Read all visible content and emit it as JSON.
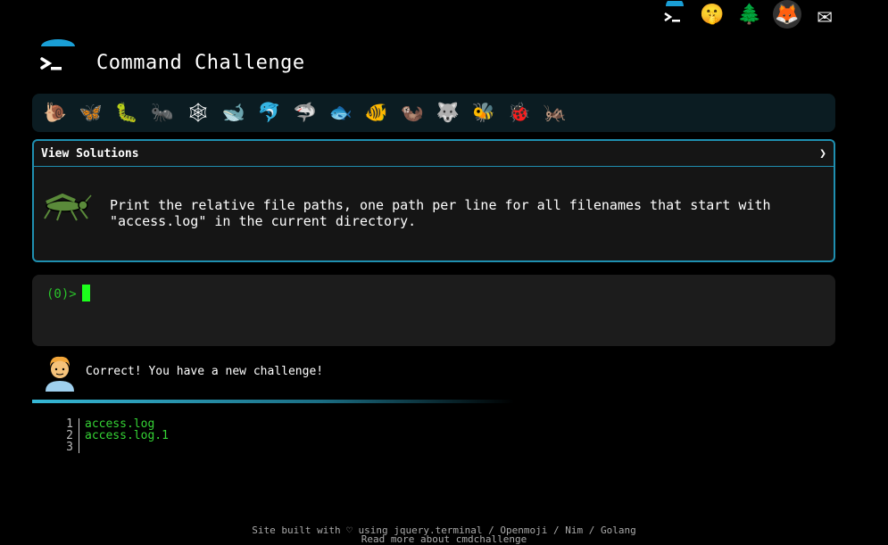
{
  "header": {
    "title": "Command Challenge",
    "top_icons": [
      {
        "name": "terminal-icon"
      },
      {
        "name": "shushing-face-icon",
        "glyph": "🤫"
      },
      {
        "name": "tree-icon",
        "glyph": "🌲"
      },
      {
        "name": "gitlab-icon",
        "glyph": "🦊"
      },
      {
        "name": "envelope-icon",
        "glyph": "✉"
      }
    ]
  },
  "animals": [
    {
      "name": "snail-icon",
      "glyph": "🐌"
    },
    {
      "name": "butterfly-icon",
      "glyph": "🦋"
    },
    {
      "name": "caterpillar-icon",
      "glyph": "🐛"
    },
    {
      "name": "ant-icon",
      "glyph": "🐜"
    },
    {
      "name": "spider-web-icon",
      "glyph": "🕸"
    },
    {
      "name": "whale-icon",
      "glyph": "🐋"
    },
    {
      "name": "dolphin-icon",
      "glyph": "🐬"
    },
    {
      "name": "shark-icon",
      "glyph": "🦈"
    },
    {
      "name": "fish-icon",
      "glyph": "🐟"
    },
    {
      "name": "tropical-fish-icon",
      "glyph": "🐠"
    },
    {
      "name": "otter-icon",
      "glyph": "🦦"
    },
    {
      "name": "wolf-icon",
      "glyph": "🐺"
    },
    {
      "name": "bee-icon",
      "glyph": "🐝"
    },
    {
      "name": "ladybug-icon",
      "glyph": "🐞"
    },
    {
      "name": "cricket-icon",
      "glyph": "🦗"
    }
  ],
  "solutions": {
    "label": "View Solutions",
    "chevron": "❯"
  },
  "challenge": {
    "text": "Print the relative file paths, one path per line for all filenames that start with \"access.log\" in the current directory."
  },
  "terminal": {
    "prompt": "(0)>"
  },
  "message": {
    "text": "Correct! You have a new challenge!"
  },
  "output": {
    "lines": [
      {
        "no": "1",
        "text": "access.log"
      },
      {
        "no": "2",
        "text": "access.log.1"
      },
      {
        "no": "3",
        "text": ""
      }
    ]
  },
  "footer": {
    "line1": "Site built with ♡ using jquery.terminal / Openmoji / Nim / Golang",
    "line2": "Read more about cmdchallenge"
  },
  "colors": {
    "accent": "#1f8fb0",
    "prompt_green": "#2ac42a",
    "output_green": "#35d435"
  }
}
